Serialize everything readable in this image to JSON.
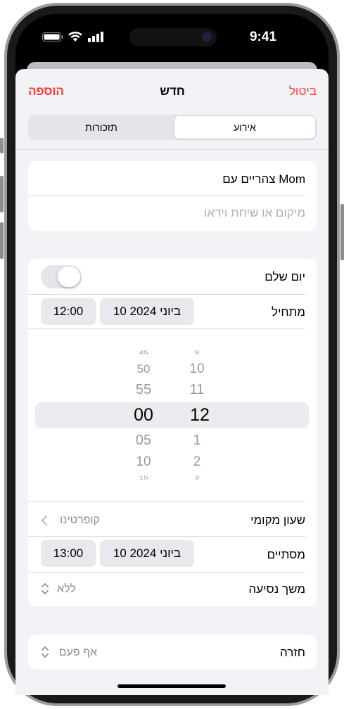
{
  "status_bar": {
    "time": "9:41"
  },
  "header": {
    "cancel": "ביטול",
    "title": "חדש",
    "add": "הוספה"
  },
  "segments": {
    "event": "אירוע",
    "reminders": "תזכורות"
  },
  "details": {
    "title_value": "צהריים עם Mom",
    "location_placeholder": "מיקום או שיחת וידאו"
  },
  "schedule": {
    "all_day_label": "יום שלם",
    "all_day_on": false,
    "starts_label": "מתחיל",
    "start_date": "10 ביוני 2024",
    "start_time": "12:00",
    "picker": {
      "hours": [
        "9",
        "10",
        "11",
        "12",
        "1",
        "2",
        "3"
      ],
      "minutes": [
        "45",
        "50",
        "55",
        "00",
        "05",
        "10",
        "15"
      ]
    },
    "timezone_label": "שעון מקומי",
    "timezone_value": "קופרטינו",
    "ends_label": "מסתיים",
    "end_date": "10 ביוני 2024",
    "end_time": "13:00",
    "travel_label": "משך נסיעה",
    "travel_value": "ללא"
  },
  "repeat": {
    "label": "חזרה",
    "value": "אף פעם"
  },
  "colors": {
    "accent": "#ff3b30",
    "background": "#f2f2f7"
  }
}
